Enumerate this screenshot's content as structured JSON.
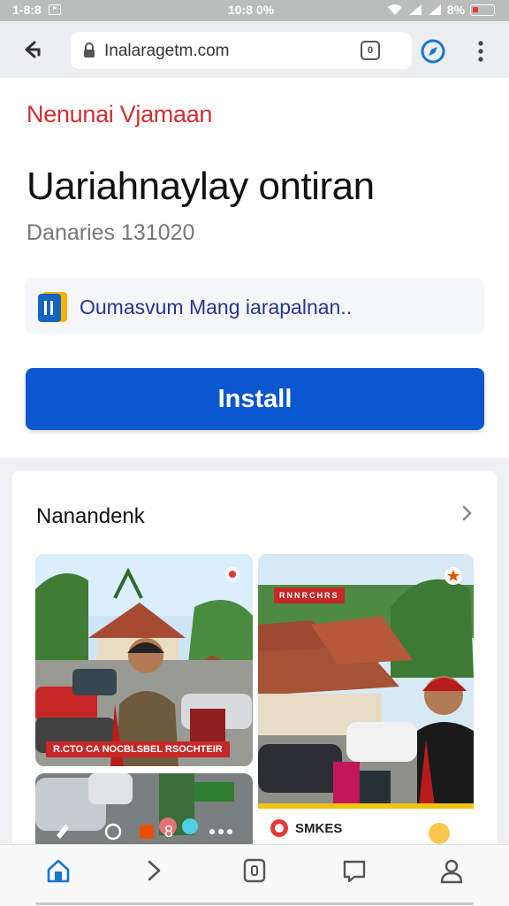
{
  "status_bar": {
    "time_left": "1-8:8",
    "center_time": "10:8 0%",
    "battery": "8%"
  },
  "browser": {
    "url": "Inalaragetm.com",
    "tab_count": "0"
  },
  "page": {
    "site_name": "Nenunai Vjamaan",
    "app_title": "Uariahnaylay ontiran",
    "app_subtitle": "Danaries 131020",
    "info_text": "Oumasvum Mang iarapalnan..",
    "install_label": "Install"
  },
  "section": {
    "title": "Nanandenk",
    "photo_a_caption": "R.CTO CA NOCBLSBEL RSOCHTEIR",
    "photo_b_banner": "RNNRCHRS",
    "photo_b_footer_label": "SMKES"
  },
  "nav": {
    "items": [
      "home-icon",
      "forward-icon",
      "tabs-icon",
      "bookmarks-icon",
      "account-icon"
    ],
    "active": "home-icon"
  },
  "colors": {
    "accent": "#0b57d0",
    "site_name": "#d32f2f",
    "active_nav": "#1976d2"
  }
}
